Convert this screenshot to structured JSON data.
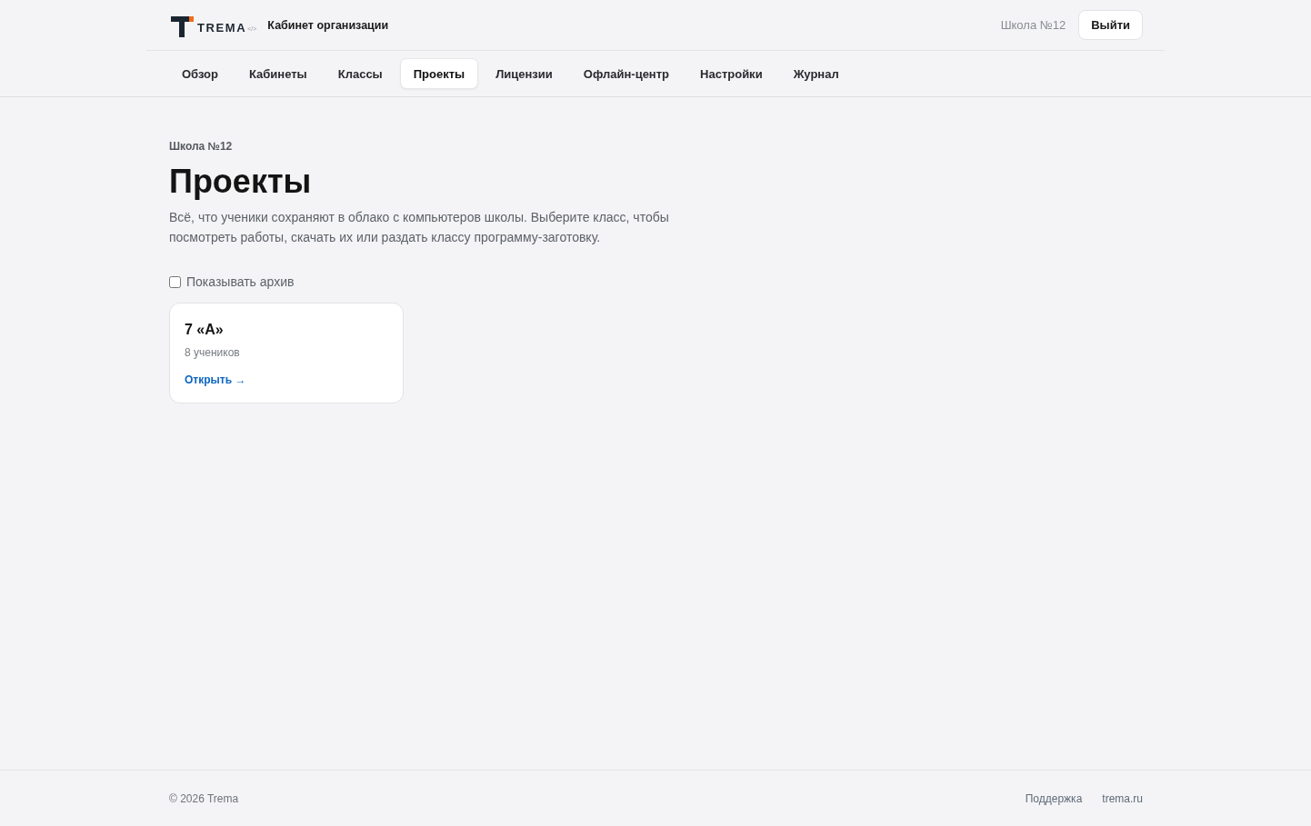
{
  "header": {
    "logo": {
      "wordmark": "TREMA",
      "code_mark": "</>"
    },
    "title": "Кабинет организации",
    "organization": "Школа №12",
    "logout_button": "Выйти"
  },
  "nav": {
    "tabs": [
      {
        "label": "Обзор",
        "selected": false
      },
      {
        "label": "Кабинеты",
        "selected": false
      },
      {
        "label": "Классы",
        "selected": false
      },
      {
        "label": "Проекты",
        "selected": true
      },
      {
        "label": "Лицензии",
        "selected": false
      },
      {
        "label": "Офлайн-центр",
        "selected": false
      },
      {
        "label": "Настройки",
        "selected": false
      },
      {
        "label": "Журнал",
        "selected": false
      }
    ]
  },
  "page": {
    "breadcrumb": "Школа №12",
    "title": "Проекты",
    "description": "Всё, что ученики сохраняют в облако с компьютеров школы. Выберите класс, чтобы посмотреть работы, скачать их или раздать классу программу-заготовку.",
    "archive_toggle": {
      "label": "Показывать архив",
      "checked": false
    }
  },
  "classes": [
    {
      "name": "7 «А»",
      "students": "8 учеников",
      "link": "Открыть →"
    }
  ],
  "footer": {
    "copyright": "© 2026 Trema",
    "links": [
      "Поддержка",
      "trema.ru"
    ]
  }
}
